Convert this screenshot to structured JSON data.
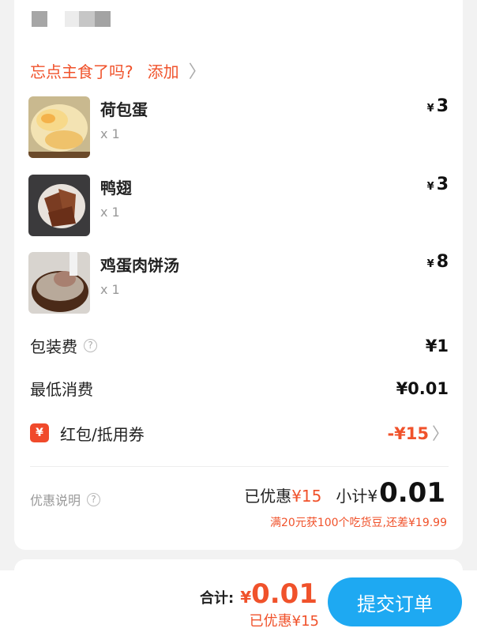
{
  "promo": {
    "text": "忘点主食了吗?",
    "action": "添加"
  },
  "items": [
    {
      "name": "荷包蛋",
      "qty": "x 1",
      "price": "3"
    },
    {
      "name": "鸭翅",
      "qty": "x 1",
      "price": "3"
    },
    {
      "name": "鸡蛋肉饼汤",
      "qty": "x 1",
      "price": "8"
    }
  ],
  "currency": "¥",
  "fees": {
    "packaging_label": "包装费",
    "packaging_value": "¥1",
    "min_label": "最低消费",
    "min_value": "¥0.01",
    "redpack_label": "红包/抵用券",
    "redpack_value": "-¥15"
  },
  "summary": {
    "explain_label": "优惠说明",
    "saved_label": "已优惠",
    "saved_value": "¥15",
    "subtotal_label": "小计¥",
    "subtotal_value": "0.01",
    "beans_note": "满20元获100个吃货豆,还差¥19.99"
  },
  "bottom": {
    "total_label": "合计:",
    "total_yen": "¥",
    "total_value": "0.01",
    "saved_text": "已优惠¥15",
    "submit_label": "提交订单"
  },
  "colors": {
    "accent": "#f0522b",
    "primary_button": "#1ea9f2"
  }
}
